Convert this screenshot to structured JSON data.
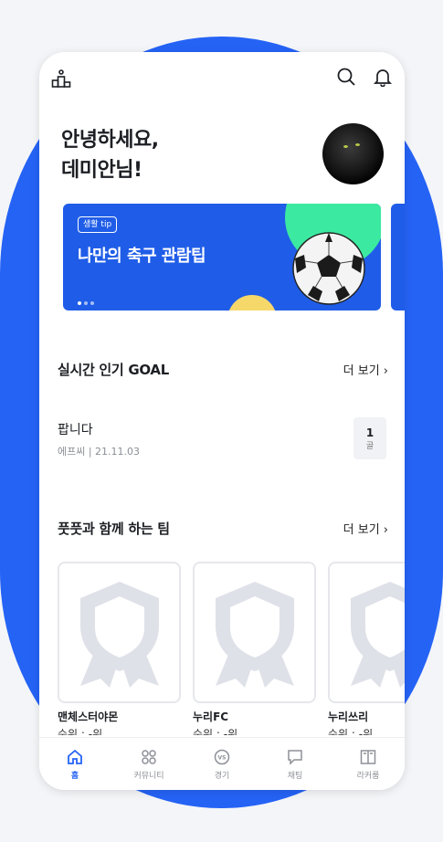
{
  "header": {
    "logo_icon": "podium-icon",
    "search_icon": "search-icon",
    "bell_icon": "bell-icon"
  },
  "greeting": {
    "line1": "안녕하세요,",
    "line2": "데미안님!"
  },
  "banner": {
    "tag": "생활 tip",
    "title": "나만의 축구 관람팁",
    "page_count": 3,
    "active_page": 1,
    "colors": {
      "bg": "#1f5de8",
      "green": "#3ce9a0",
      "yellow": "#f6d86a"
    }
  },
  "popular": {
    "title": "실시간 인기 GOAL",
    "more": "더 보기",
    "posts": [
      {
        "title": "팝니다",
        "meta": "에프씨 | 21.11.03",
        "goal_count": "1",
        "goal_unit": "골"
      }
    ]
  },
  "teams_section": {
    "title": "풋풋과 함께 하는 팀",
    "more": "더 보기",
    "teams": [
      {
        "name": "맨체스터야몬",
        "rank": "순위 : -위"
      },
      {
        "name": "누리FC",
        "rank": "순위 : -위"
      },
      {
        "name": "누리쓰리",
        "rank": "순위 : -위"
      }
    ]
  },
  "tabbar": {
    "items": [
      {
        "label": "홈",
        "icon": "home-icon",
        "active": true
      },
      {
        "label": "커뮤니티",
        "icon": "community-icon",
        "active": false
      },
      {
        "label": "경기",
        "icon": "vs-icon",
        "active": false
      },
      {
        "label": "채팅",
        "icon": "chat-icon",
        "active": false
      },
      {
        "label": "라커룸",
        "icon": "locker-icon",
        "active": false
      }
    ]
  },
  "colors": {
    "accent": "#2563f5",
    "background_blob": "#2563f5"
  }
}
